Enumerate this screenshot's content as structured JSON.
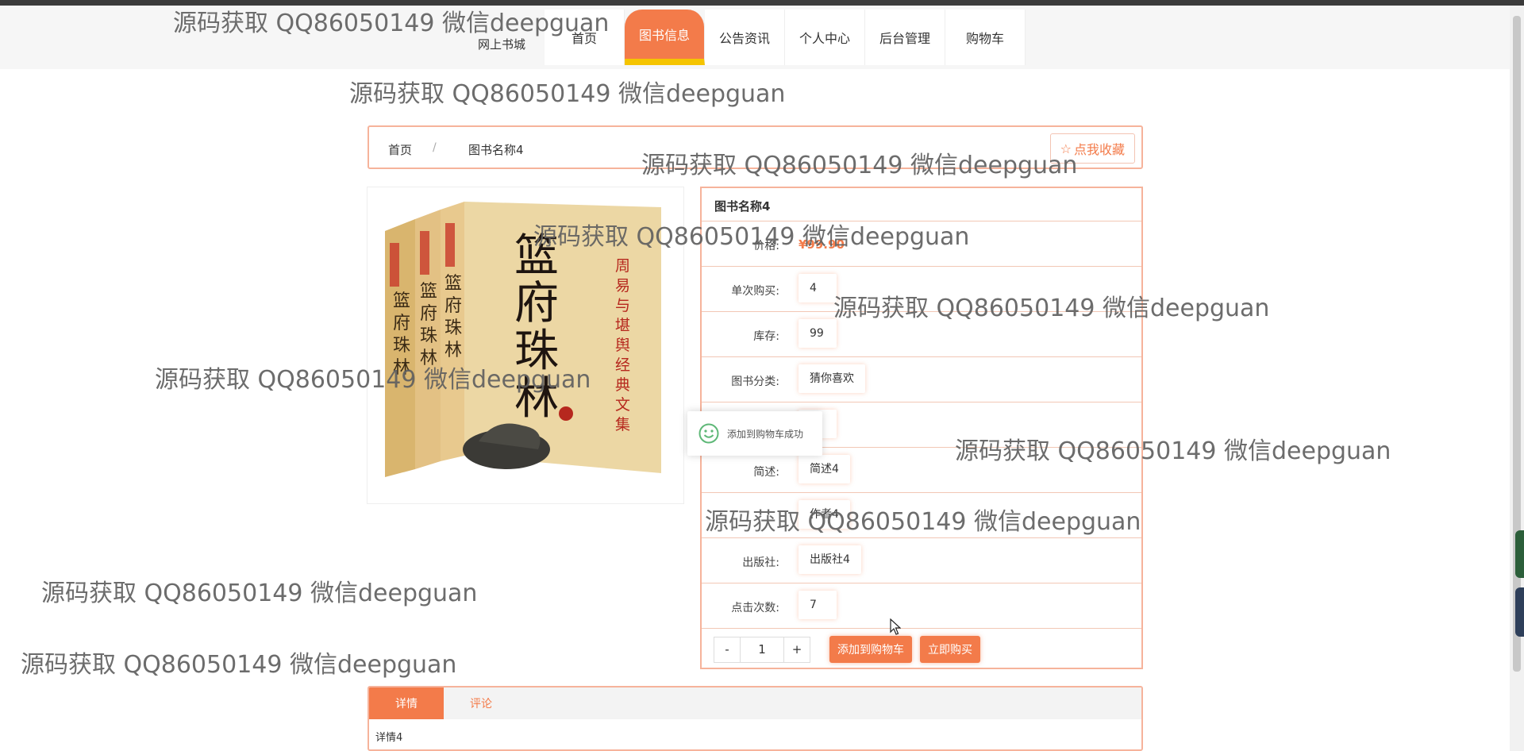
{
  "site": {
    "title": "网上书城"
  },
  "nav": {
    "items": [
      "首页",
      "图书信息",
      "公告资讯",
      "个人中心",
      "后台管理",
      "购物车"
    ],
    "active_index": 1
  },
  "breadcrumb": {
    "home": "首页",
    "separator": "/",
    "current": "图书名称4"
  },
  "favorite_button": {
    "label": "点我收藏"
  },
  "book": {
    "name": "图书名称4",
    "price_label": "价格:",
    "price": "¥99.90",
    "fields": [
      {
        "label": "单次购买:",
        "value": "4"
      },
      {
        "label": "库存:",
        "value": "99"
      },
      {
        "label": "图书分类:",
        "value": "猜你喜欢"
      },
      {
        "label": "",
        "value": "科"
      },
      {
        "label": "简述:",
        "value": "简述4"
      },
      {
        "label": "",
        "value": "作者4"
      },
      {
        "label": "出版社:",
        "value": "出版社4"
      },
      {
        "label": "点击次数:",
        "value": "7"
      }
    ]
  },
  "quantity": {
    "minus": "-",
    "value": "1",
    "plus": "+"
  },
  "actions": {
    "add_to_cart": "添加到购物车",
    "buy_now": "立即购买"
  },
  "toast": {
    "message": "添加到购物车成功"
  },
  "tabs": {
    "items": [
      "详情",
      "评论"
    ],
    "active_index": 0,
    "content": "详情4"
  },
  "watermark": {
    "text": "源码获取 QQ86050149 微信deepguan"
  },
  "colors": {
    "accent": "#f37b4a",
    "border": "#f6b39b",
    "nav_active_bottom": "#f5c400"
  }
}
